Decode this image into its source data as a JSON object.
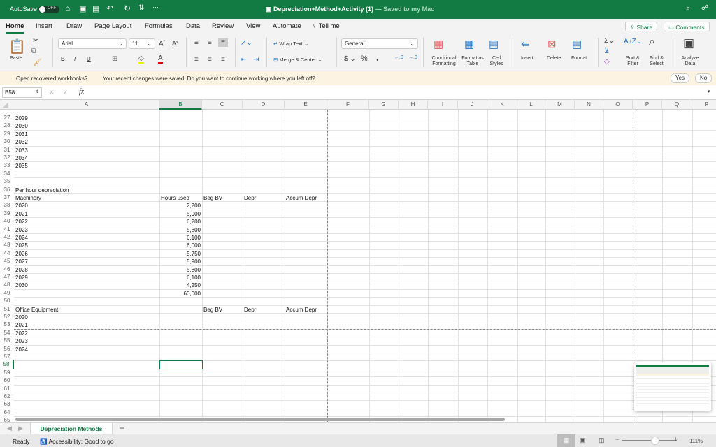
{
  "titlebar": {
    "autosave_label": "AutoSave",
    "autosave_state": "OFF",
    "doc_title": "Depreciation+Method+Activity (1)",
    "save_status": "— Saved to my Mac",
    "bg_color": "#127a43"
  },
  "tabs": [
    "Home",
    "Insert",
    "Draw",
    "Page Layout",
    "Formulas",
    "Data",
    "Review",
    "View",
    "Automate"
  ],
  "tell_me": "Tell me",
  "share_label": "Share",
  "comments_label": "Comments",
  "ribbon": {
    "paste": "Paste",
    "font": "Arial",
    "font_size": "11",
    "wrap_text": "Wrap Text",
    "merge_center": "Merge & Center",
    "number_format": "General",
    "conditional_formatting": "Conditional Formatting",
    "format_as_table": "Format as Table",
    "cell_styles": "Cell Styles",
    "insert": "Insert",
    "delete": "Delete",
    "format": "Format",
    "sort_filter": "Sort & Filter",
    "find_select": "Find & Select",
    "analyze_data": "Analyze Data",
    "bold": "B",
    "italic": "I",
    "underline": "U"
  },
  "message": {
    "title": "Open recovered workbooks?",
    "text": "Your recent changes were saved. Do you want to continue working where you left off?",
    "yes": "Yes",
    "no": "No"
  },
  "formula_bar": {
    "name_box": "B58",
    "fx": "fx",
    "value": ""
  },
  "columns": [
    "A",
    "B",
    "C",
    "D",
    "E",
    "F",
    "G",
    "H",
    "I",
    "J",
    "K",
    "L",
    "M",
    "N",
    "O",
    "P",
    "Q",
    "R"
  ],
  "selected_cell": {
    "col": "B",
    "row": 58
  },
  "rows": [
    {
      "r": 27,
      "A": "2029"
    },
    {
      "r": 28,
      "A": "2030"
    },
    {
      "r": 29,
      "A": "2031"
    },
    {
      "r": 30,
      "A": "2032"
    },
    {
      "r": 31,
      "A": "2033"
    },
    {
      "r": 32,
      "A": "2034"
    },
    {
      "r": 33,
      "A": "2035"
    },
    {
      "r": 34
    },
    {
      "r": 35
    },
    {
      "r": 36,
      "A": "Per hour depreciation"
    },
    {
      "r": 37,
      "A": "Machinery",
      "B": "Hours used",
      "C": "Beg BV",
      "D": "Depr",
      "E": "Accum Depr"
    },
    {
      "r": 38,
      "A": "2020",
      "B": "2,200"
    },
    {
      "r": 39,
      "A": "2021",
      "B": "5,900"
    },
    {
      "r": 40,
      "A": "2022",
      "B": "6,200"
    },
    {
      "r": 41,
      "A": "2023",
      "B": "5,800"
    },
    {
      "r": 42,
      "A": "2024",
      "B": "6,100"
    },
    {
      "r": 43,
      "A": "2025",
      "B": "6,000"
    },
    {
      "r": 44,
      "A": "2026",
      "B": "5,750"
    },
    {
      "r": 45,
      "A": "2027",
      "B": "5,900"
    },
    {
      "r": 46,
      "A": "2028",
      "B": "5,800"
    },
    {
      "r": 47,
      "A": "2029",
      "B": "6,100"
    },
    {
      "r": 48,
      "A": "2030",
      "B": "4,250"
    },
    {
      "r": 49,
      "B": "60,000"
    },
    {
      "r": 50
    },
    {
      "r": 51,
      "A": "Office Equipment",
      "C": "Beg BV",
      "D": "Depr",
      "E": "Accum Depr"
    },
    {
      "r": 52,
      "A": "2020"
    },
    {
      "r": 53,
      "A": "2021"
    },
    {
      "r": 54,
      "A": "2022"
    },
    {
      "r": 55,
      "A": "2023"
    },
    {
      "r": 56,
      "A": "2024"
    },
    {
      "r": 57
    },
    {
      "r": 58
    },
    {
      "r": 59
    },
    {
      "r": 60
    },
    {
      "r": 61
    },
    {
      "r": 62
    },
    {
      "r": 63
    },
    {
      "r": 64
    },
    {
      "r": 65
    }
  ],
  "sheet_tab": "Depreciation Methods",
  "status": {
    "ready": "Ready",
    "accessibility": "Accessibility: Good to go",
    "zoom": "111%",
    "zoom_level": 0.6
  }
}
